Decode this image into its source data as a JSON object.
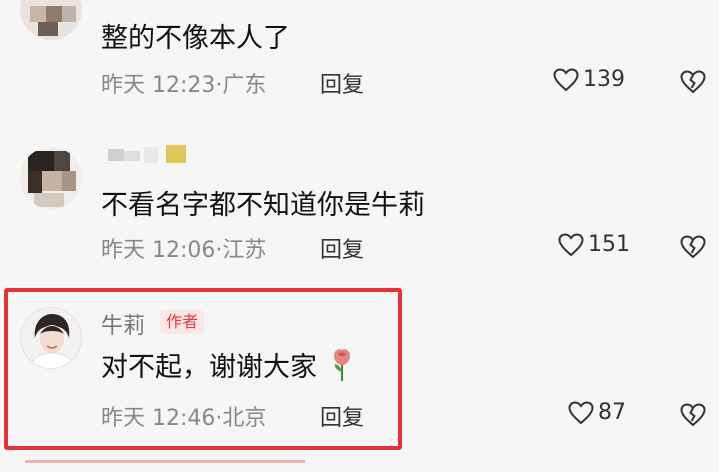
{
  "comments": [
    {
      "name": "",
      "is_author": false,
      "text": "整的不像本人了",
      "time": "昨天 12:23",
      "location": "广东",
      "reply_label": "回复",
      "likes": "139"
    },
    {
      "name": "",
      "is_author": false,
      "text": "不看名字都不知道你是牛莉",
      "time": "昨天 12:06",
      "location": "江苏",
      "reply_label": "回复",
      "likes": "151"
    },
    {
      "name": "牛莉",
      "is_author": true,
      "author_tag": "作者",
      "text": "对不起，谢谢大家",
      "time": "昨天 12:46",
      "location": "北京",
      "reply_label": "回复",
      "likes": "87"
    }
  ],
  "colors": {
    "highlight": "#e53238",
    "author_tag": "#e5393f",
    "meta": "#888888"
  },
  "icons": [
    "heart-icon",
    "broken-heart-icon",
    "rose-emoji"
  ]
}
